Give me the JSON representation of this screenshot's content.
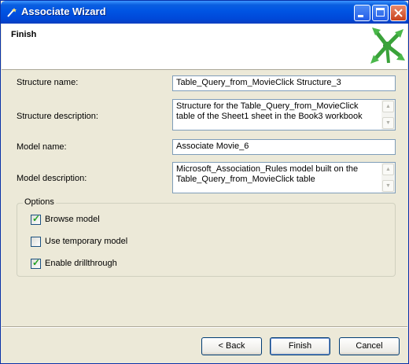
{
  "window": {
    "title": "Associate Wizard"
  },
  "header": {
    "title": "Finish"
  },
  "form": {
    "structure_name": {
      "label": "Structure name:",
      "value": "Table_Query_from_MovieClick Structure_3"
    },
    "structure_description": {
      "label": "Structure description:",
      "value": "Structure for the Table_Query_from_MovieClick table of the Sheet1 sheet in the Book3 workbook"
    },
    "model_name": {
      "label": "Model name:",
      "value": "Associate Movie_6"
    },
    "model_description": {
      "label": "Model description:",
      "value": "Microsoft_Association_Rules model built on the Table_Query_from_MovieClick table"
    }
  },
  "options": {
    "title": "Options",
    "items": [
      {
        "label": "Browse model",
        "checked": true
      },
      {
        "label": "Use temporary model",
        "checked": false
      },
      {
        "label": "Enable drillthrough",
        "checked": true
      }
    ]
  },
  "buttons": {
    "back": "< Back",
    "finish": "Finish",
    "cancel": "Cancel"
  }
}
